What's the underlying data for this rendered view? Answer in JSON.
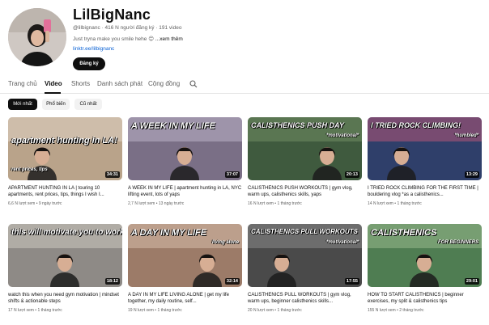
{
  "channel": {
    "name": "LilBigNanc",
    "handle": "@lilbignanc",
    "meta_rest": "· 416 N người đăng ký · 191 video",
    "description": "Just tryna make you smile hehe 😊",
    "more": "...xem thêm",
    "link": "linktr.ee/lilbignanc",
    "subscribe_label": "Đăng ký"
  },
  "tabs": [
    {
      "label": "Trang chủ",
      "active": false
    },
    {
      "label": "Video",
      "active": true
    },
    {
      "label": "Shorts",
      "active": false
    },
    {
      "label": "Danh sách phát",
      "active": false
    },
    {
      "label": "Cộng đồng",
      "active": false
    }
  ],
  "chips": [
    {
      "label": "Mới nhất",
      "active": true
    },
    {
      "label": "Phổ biến",
      "active": false
    },
    {
      "label": "Cũ nhất",
      "active": false
    }
  ],
  "icons": {
    "search": "search-icon"
  },
  "videos": [
    {
      "title": "APARTMENT HUNTING IN LA | touring 10 apartments, rent prices, tips, things I wish I...",
      "views": "6,6 N lượt xem",
      "age": "9 ngày trước",
      "duration": "34:31",
      "caption": "apartment hunting in LA!",
      "caption2": "rent prices, tips",
      "bg": "#b9a38a",
      "accent": "#e8ddd0"
    },
    {
      "title": "A WEEK IN MY LIFE | apartment hunting in LA, NYC lifting event, lots of yaps",
      "views": "2,7 N lượt xem",
      "age": "13 ngày trước",
      "duration": "37:07",
      "caption": "A WEEK IN MY LIFE",
      "caption2": "",
      "bg": "#7a6f86",
      "accent": "#c9c0d6"
    },
    {
      "title": "CALISTHENICS PUSH WORKOUTS | gym vlog, warm ups, calisthenics skills, yaps",
      "views": "16 N lượt xem",
      "age": "1 tháng trước",
      "duration": "20:13",
      "caption": "CALISTHENICS PUSH DAY",
      "caption2": "*motivational*",
      "bg": "#3f5a3e",
      "accent": "#7c9a6a"
    },
    {
      "title": "I TRIED ROCK CLIMBING FOR THE FIRST TIME | bouldering vlog *as a calisthenics...",
      "views": "14 N lượt xem",
      "age": "1 tháng trước",
      "duration": "13:29",
      "caption": "I TRIED ROCK CLIMBING!",
      "caption2": "*humbled*",
      "bg": "#2f3f6a",
      "accent": "#d35b7a"
    },
    {
      "title": "watch this when you need gym motivation | mindset shifts & actionable steps",
      "views": "17 N lượt xem",
      "age": "1 tháng trước",
      "duration": "18:12",
      "caption": "this will motivate you to work out",
      "caption2": "",
      "bg": "#8e8a86",
      "accent": "#d9d4cd"
    },
    {
      "title": "A DAY IN MY LIFE LIVING ALONE | get my life together, my daily routine, self...",
      "views": "19 N lượt xem",
      "age": "1 tháng trước",
      "duration": "32:14",
      "caption": "A DAY IN MY LIFE",
      "caption2": "living alone",
      "bg": "#9c7b68",
      "accent": "#e5cdb9"
    },
    {
      "title": "CALISTHENICS PULL WORKOUTS | gym vlog, warm ups, beginner calisthenics skills...",
      "views": "20 N lượt xem",
      "age": "1 tháng trước",
      "duration": "17:55",
      "caption": "CALISTHENICS PULL WORKOUTS",
      "caption2": "*motivational*",
      "bg": "#4a4a4a",
      "accent": "#9a9a9a"
    },
    {
      "title": "HOW TO START CALISTHENICS | beginner exercises, my split & calisthenics tips",
      "views": "155 N lượt xem",
      "age": "2 tháng trước",
      "duration": "29:01",
      "caption": "CALISTHENICS",
      "caption2": "FOR BEGINNERS",
      "bg": "#4f7d52",
      "accent": "#a9c79a"
    }
  ]
}
